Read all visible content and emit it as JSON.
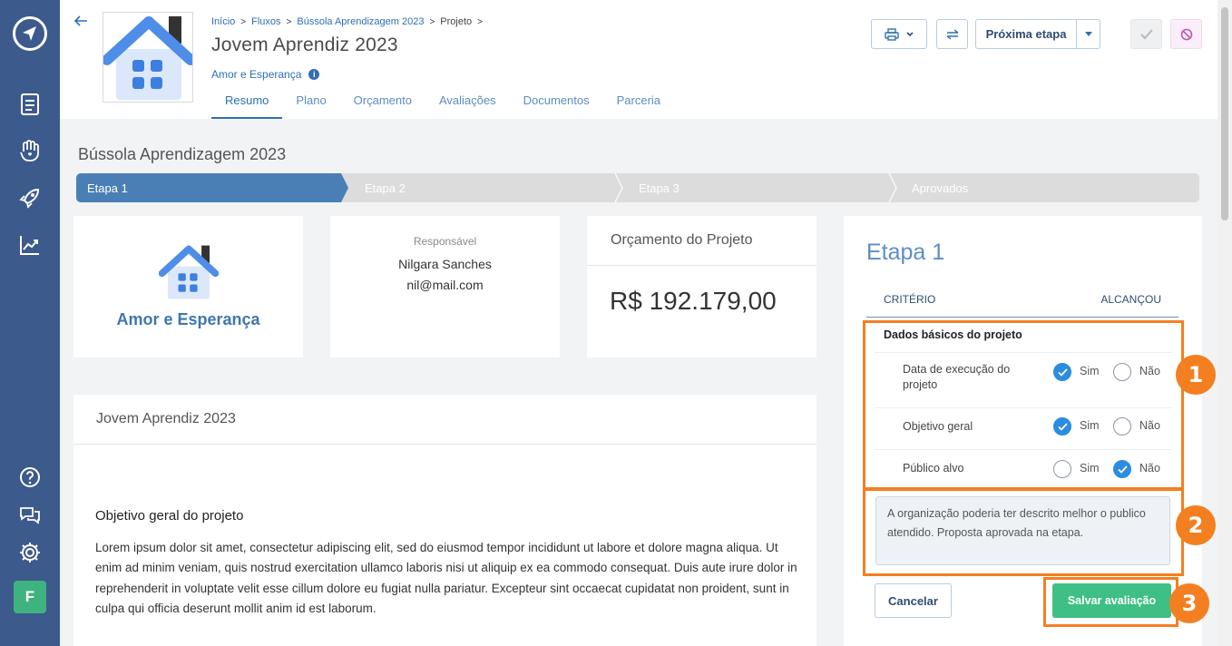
{
  "header": {
    "breadcrumb": [
      "Início",
      "Fluxos",
      "Bússola Aprendizagem 2023",
      "Projeto"
    ],
    "title": "Jovem Aprendiz 2023",
    "organization": "Amor e Esperança",
    "tabs": [
      "Resumo",
      "Plano",
      "Orçamento",
      "Avaliações",
      "Documentos",
      "Parceria"
    ],
    "active_tab": "Resumo",
    "next_step_label": "Próxima etapa"
  },
  "flow": {
    "title": "Bússola Aprendizagem 2023",
    "steps": [
      "Etapa 1",
      "Etapa 2",
      "Etapa 3",
      "Aprovados"
    ],
    "current_step": 1
  },
  "org_card": {
    "name": "Amor e Esperança"
  },
  "responsible_card": {
    "label": "Responsável",
    "name": "Nilgara Sanches",
    "email": "nil@mail.com"
  },
  "budget_card": {
    "label": "Orçamento do Projeto",
    "value": "R$ 192.179,00"
  },
  "document": {
    "header": "Jovem Aprendiz 2023",
    "section_title": "Objetivo geral do projeto",
    "paragraph": "Lorem ipsum dolor sit amet, consectetur adipiscing elit, sed do eiusmod tempor incididunt ut labore et dolore magna aliqua. Ut enim ad minim veniam, quis nostrud exercitation ullamco laboris nisi ut aliquip ex ea commodo consequat. Duis aute irure dolor in reprehenderit in voluptate velit esse cillum dolore eu fugiat nulla pariatur. Excepteur sint occaecat cupidatat non proident, sunt in culpa qui officia deserunt mollit anim id est laborum."
  },
  "evaluation": {
    "stage_title": "Etapa 1",
    "col_criteria": "CRITÉRIO",
    "col_achieved": "ALCANÇOU",
    "group_title": "Dados básicos do projeto",
    "yes_label": "Sim",
    "no_label": "Não",
    "criteria": [
      {
        "text": "Data de execução do projeto",
        "answer": "Sim"
      },
      {
        "text": "Objetivo geral",
        "answer": "Sim"
      },
      {
        "text": "Público alvo",
        "answer": "Não"
      }
    ],
    "comment": "A organização poderia ter descrito melhor o publico atendido. Proposta aprovada na etapa.",
    "cancel_label": "Cancelar",
    "save_label": "Salvar avaliação"
  },
  "annotations": [
    "1",
    "2",
    "3"
  ],
  "colors": {
    "rail": "#3c5a8c",
    "accent": "#2f6fb3",
    "save_button": "#3ebf85",
    "highlight": "#f47f20",
    "avatar": "#3fb37f"
  },
  "user_avatar_initial": "F"
}
